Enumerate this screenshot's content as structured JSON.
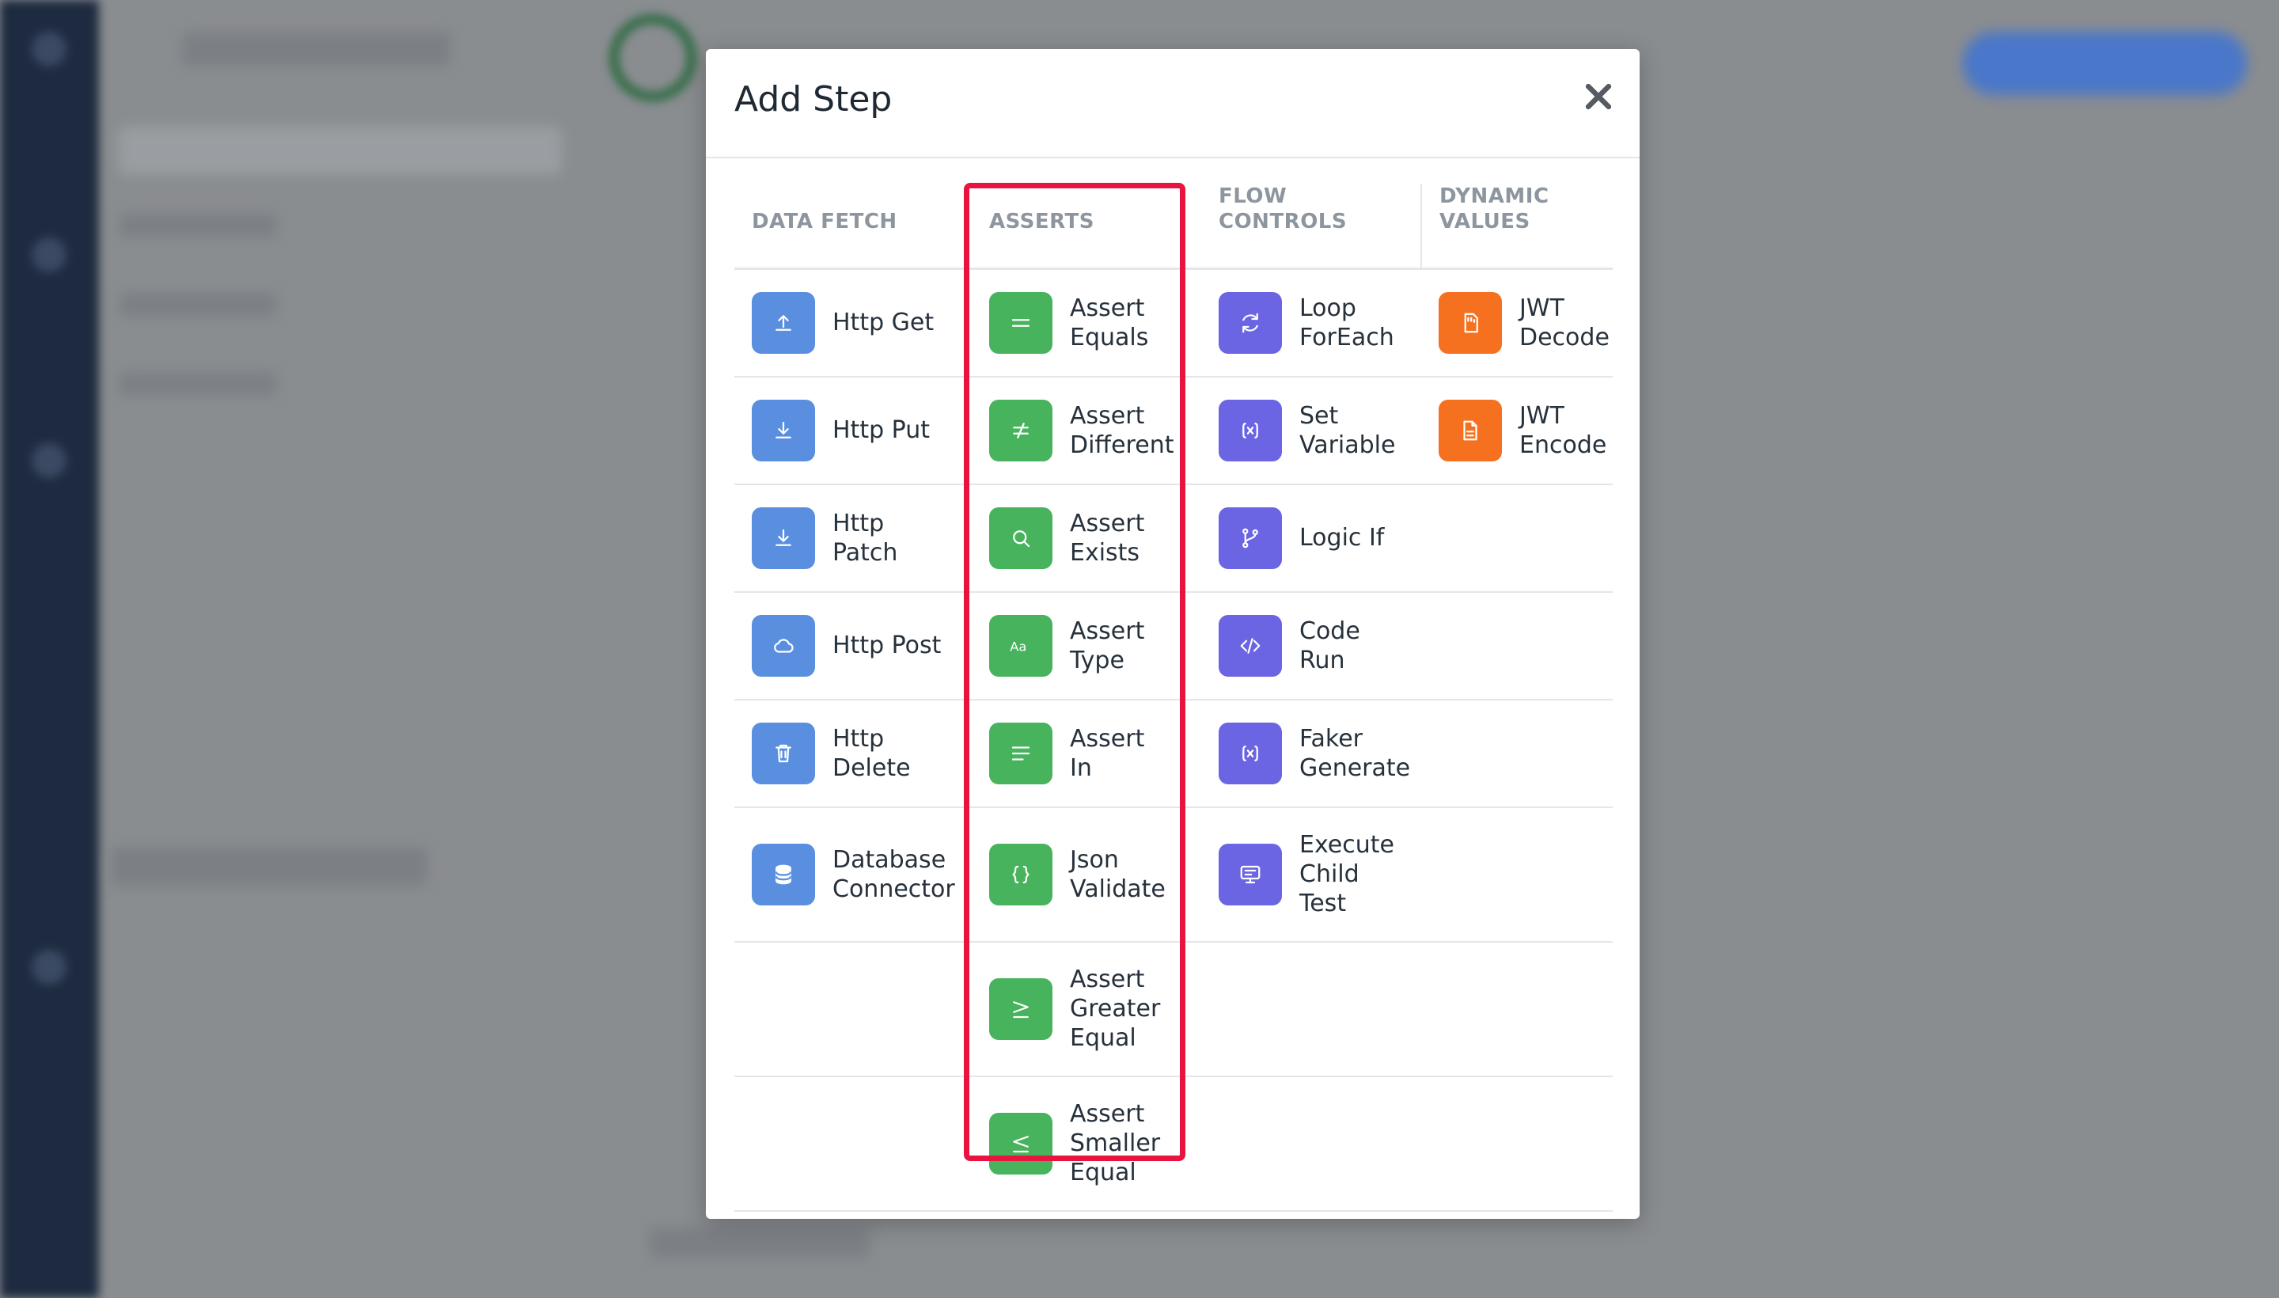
{
  "modal": {
    "title": "Add Step",
    "close_icon": "close-icon"
  },
  "columns": [
    {
      "key": "data_fetch",
      "header": "DATA FETCH"
    },
    {
      "key": "asserts",
      "header": "ASSERTS"
    },
    {
      "key": "flow_controls",
      "header": "FLOW CONTROLS"
    },
    {
      "key": "dynamic_values",
      "header": "DYNAMIC\nVALUES"
    }
  ],
  "rows": [
    {
      "data_fetch": {
        "label": "Http Get",
        "icon": "upload-icon",
        "color": "#5a8fdf"
      },
      "asserts": {
        "label": "Assert\nEquals",
        "icon": "equals-icon",
        "color": "#47b35c"
      },
      "flow_controls": {
        "label": "Loop\nForEach",
        "icon": "refresh-icon",
        "color": "#6b64e3"
      },
      "dynamic_values": {
        "label": "JWT\nDecode",
        "icon": "sd-card-icon",
        "color": "#f5711f"
      }
    },
    {
      "data_fetch": {
        "label": "Http Put",
        "icon": "download-icon",
        "color": "#5a8fdf"
      },
      "asserts": {
        "label": "Assert\nDifferent",
        "icon": "not-equal-icon",
        "color": "#47b35c"
      },
      "flow_controls": {
        "label": "Set\nVariable",
        "icon": "variable-icon",
        "color": "#6b64e3"
      },
      "dynamic_values": {
        "label": "JWT\nEncode",
        "icon": "file-icon",
        "color": "#f5711f"
      }
    },
    {
      "data_fetch": {
        "label": "Http\nPatch",
        "icon": "download-icon",
        "color": "#5a8fdf"
      },
      "asserts": {
        "label": "Assert\nExists",
        "icon": "search-icon",
        "color": "#47b35c"
      },
      "flow_controls": {
        "label": "Logic If",
        "icon": "git-branch-icon",
        "color": "#6b64e3"
      },
      "dynamic_values": null
    },
    {
      "data_fetch": {
        "label": "Http Post",
        "icon": "cloud-icon",
        "color": "#5a8fdf"
      },
      "asserts": {
        "label": "Assert\nType",
        "icon": "text-type-icon",
        "color": "#47b35c"
      },
      "flow_controls": {
        "label": "Code\nRun",
        "icon": "code-icon",
        "color": "#6b64e3"
      },
      "dynamic_values": null
    },
    {
      "data_fetch": {
        "label": "Http\nDelete",
        "icon": "trash-icon",
        "color": "#5a8fdf"
      },
      "asserts": {
        "label": "Assert\nIn",
        "icon": "align-left-icon",
        "color": "#47b35c"
      },
      "flow_controls": {
        "label": "Faker\nGenerate",
        "icon": "variable-icon",
        "color": "#6b64e3"
      },
      "dynamic_values": null
    },
    {
      "data_fetch": {
        "label": "Database\nConnector",
        "icon": "database-icon",
        "color": "#5a8fdf"
      },
      "asserts": {
        "label": "Json\nValidate",
        "icon": "braces-icon",
        "color": "#47b35c"
      },
      "flow_controls": {
        "label": "Execute\nChild\nTest",
        "icon": "child-test-icon",
        "color": "#6b64e3"
      },
      "dynamic_values": null
    },
    {
      "data_fetch": null,
      "asserts": {
        "label": "Assert\nGreater\nEqual",
        "icon": "greater-equal-icon",
        "color": "#47b35c"
      },
      "flow_controls": null,
      "dynamic_values": null
    },
    {
      "data_fetch": null,
      "asserts": {
        "label": "Assert\nSmaller\nEqual",
        "icon": "less-equal-icon",
        "color": "#47b35c"
      },
      "flow_controls": null,
      "dynamic_values": null
    }
  ],
  "highlight_color": "#e8143f"
}
